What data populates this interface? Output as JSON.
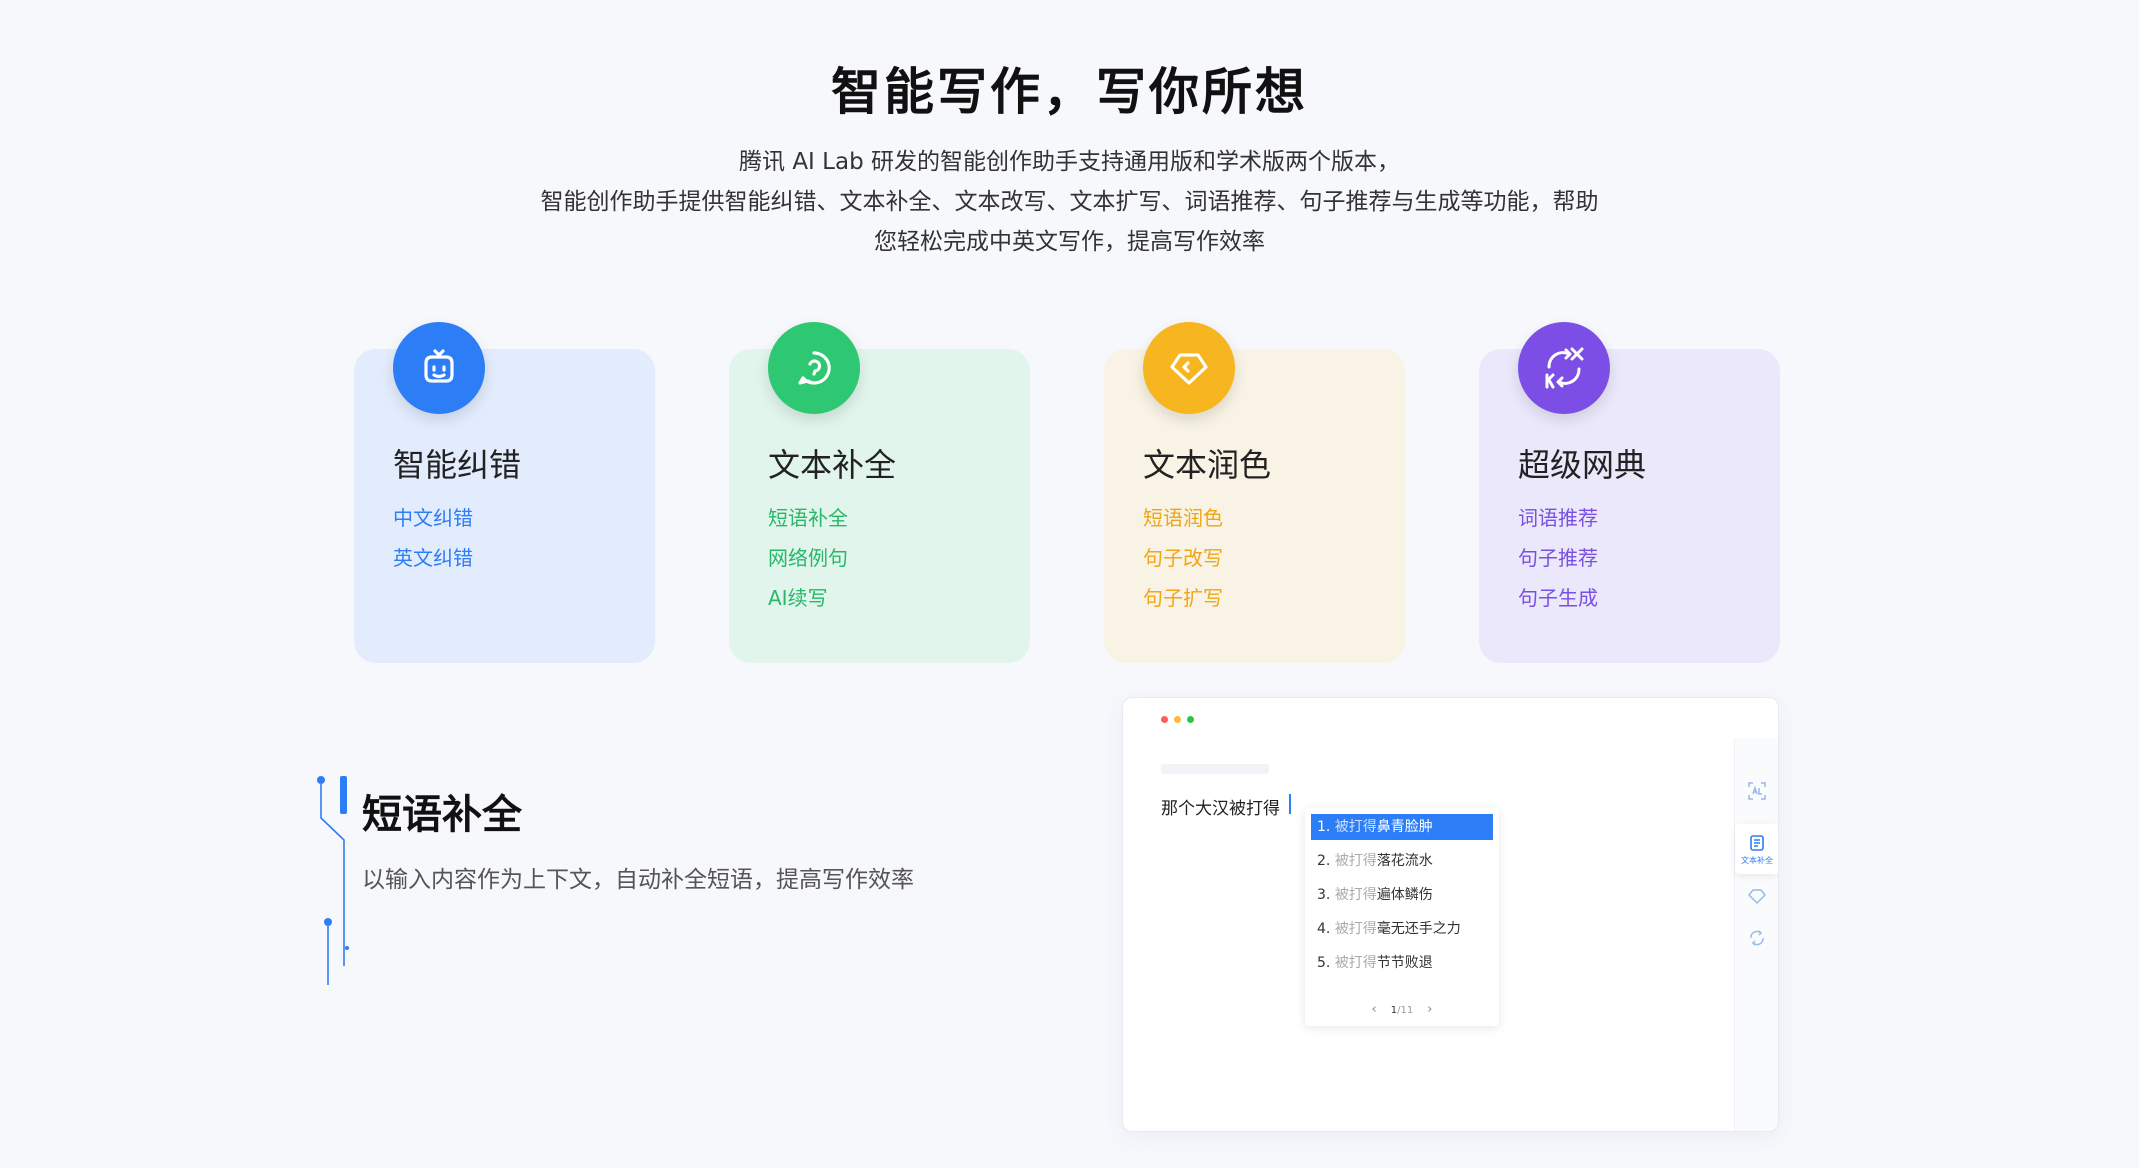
{
  "hero": {
    "title": "智能写作，写你所想",
    "desc_line1": "腾讯 AI Lab 研发的智能创作助手支持通用版和学术版两个版本，",
    "desc_line2": "智能创作助手提供智能纠错、文本补全、文本改写、文本扩写、词语推荐、句子推荐与生成等功能，帮助",
    "desc_line3": "您轻松完成中英文写作，提高写作效率"
  },
  "cards": [
    {
      "title": "智能纠错",
      "icon": "robot-face-icon",
      "color": "#2d7df6",
      "items": [
        "中文纠错",
        "英文纠错"
      ]
    },
    {
      "title": "文本补全",
      "icon": "chat-bubble-icon",
      "color": "#2ec772",
      "items": [
        "短语补全",
        "网络例句",
        "AI续写"
      ]
    },
    {
      "title": "文本润色",
      "icon": "diamond-icon",
      "color": "#f7b51f",
      "items": [
        "短语润色",
        "句子改写",
        "句子扩写"
      ]
    },
    {
      "title": "超级网典",
      "icon": "swap-letters-icon",
      "color": "#7c4ee6",
      "items": [
        "词语推荐",
        "句子推荐",
        "句子生成"
      ]
    }
  ],
  "feature": {
    "title": "短语补全",
    "desc": "以输入内容作为上下文，自动补全短语，提高写作效率"
  },
  "demo": {
    "input_text": "那个大汉被打得",
    "suggestions": [
      {
        "num": "1.",
        "prefix": "被打得",
        "text": "鼻青脸肿",
        "selected": true
      },
      {
        "num": "2.",
        "prefix": "被打得",
        "text": "落花流水",
        "selected": false
      },
      {
        "num": "3.",
        "prefix": "被打得",
        "text": "遍体鳞伤",
        "selected": false
      },
      {
        "num": "4.",
        "prefix": "被打得",
        "text": "毫无还手之力",
        "selected": false
      },
      {
        "num": "5.",
        "prefix": "被打得",
        "text": "节节败退",
        "selected": false
      }
    ],
    "pager_current": "1",
    "pager_sep": "/",
    "pager_total": "11",
    "rail_active_label": "文本补全"
  }
}
